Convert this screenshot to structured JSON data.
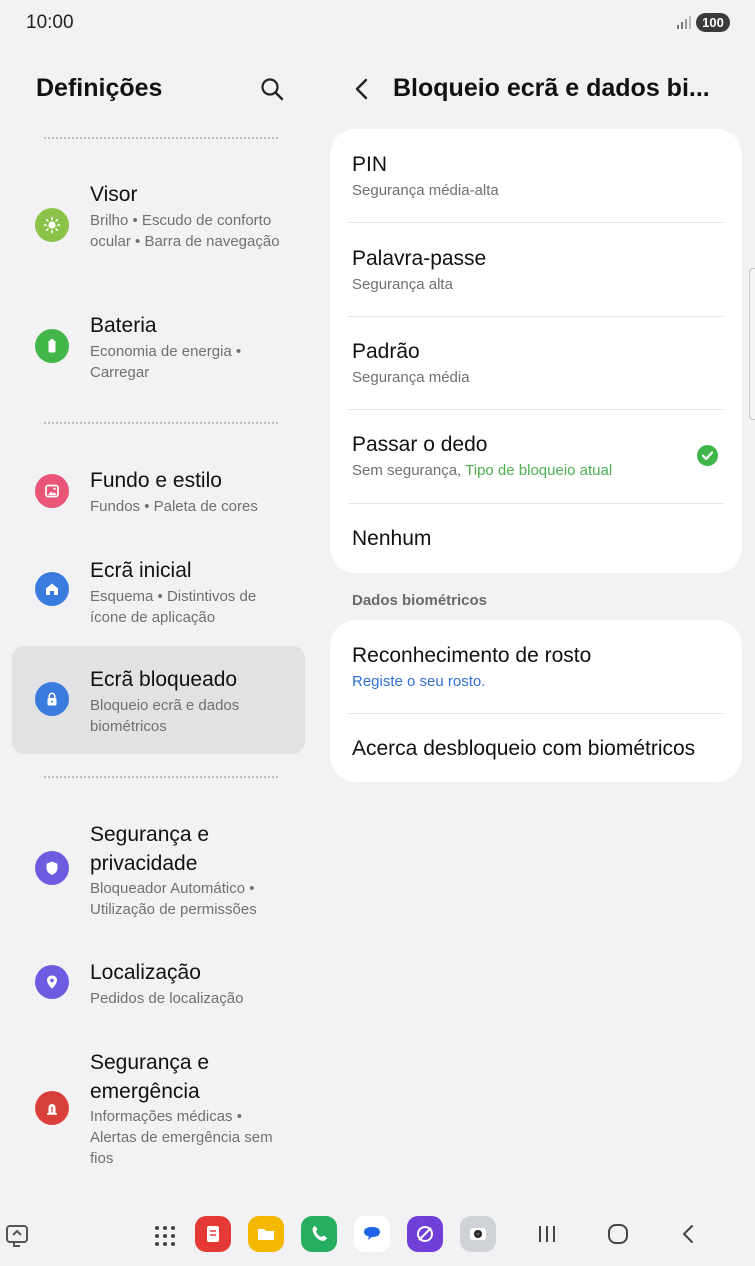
{
  "status_bar": {
    "time": "10:00",
    "battery": "100"
  },
  "settings_panel": {
    "title": "Definições",
    "items": [
      {
        "title": "Visor",
        "subtitle": "Brilho  •  Escudo de conforto ocular  •  Barra de navegação",
        "icon": "sun-icon",
        "color": "#8bc34a"
      },
      {
        "title": "Bateria",
        "subtitle": "Economia de energia  •  Carregar",
        "icon": "battery-icon",
        "color": "#43b649"
      },
      {
        "title": "Fundo e estilo",
        "subtitle": "Fundos  •  Paleta de cores",
        "icon": "image-icon",
        "color": "#e85577"
      },
      {
        "title": "Ecrã inicial",
        "subtitle": "Esquema  •  Distintivos de ícone de aplicação",
        "icon": "home-icon",
        "color": "#3a7be0"
      },
      {
        "title": "Ecrã bloqueado",
        "subtitle": "Bloqueio ecrã e dados biométricos",
        "icon": "lock-icon",
        "color": "#3a7be0"
      },
      {
        "title": "Segurança e privacidade",
        "subtitle": "Bloqueador Automático  •  Utilização de permissões",
        "icon": "shield-icon",
        "color": "#6d5be0"
      },
      {
        "title": "Localização",
        "subtitle": "Pedidos de localização",
        "icon": "location-pin-icon",
        "color": "#6d5be0"
      },
      {
        "title": "Segurança e emergência",
        "subtitle": "Informações médicas  •  Alertas de emergência sem fios",
        "icon": "emergency-icon",
        "color": "#d9403a"
      }
    ]
  },
  "detail_panel": {
    "title": "Bloqueio ecrã e dados bi...",
    "lock_types": [
      {
        "title": "PIN",
        "subtitle": "Segurança média-alta"
      },
      {
        "title": "Palavra-passe",
        "subtitle": "Segurança alta"
      },
      {
        "title": "Padrão",
        "subtitle": "Segurança média"
      },
      {
        "title": "Passar o dedo",
        "subtitle": "Sem segurança,",
        "subtitle_highlight": "Tipo de bloqueio atual",
        "selected": true
      },
      {
        "title": "Nenhum"
      }
    ],
    "biometrics_label": "Dados biométricos",
    "biometrics": [
      {
        "title": "Reconhecimento de rosto",
        "subtitle": "Registe o seu rosto."
      },
      {
        "title": "Acerca desbloqueio com biométricos"
      }
    ]
  },
  "navbar": {
    "apps": [
      "apps-grid-icon",
      "notes-app-icon",
      "files-app-icon",
      "phone-app-icon",
      "messages-app-icon",
      "internet-app-icon",
      "camera-app-icon"
    ],
    "buttons": [
      "recents-button",
      "home-button",
      "back-button"
    ]
  },
  "colors": {
    "accent_green": "#4caf50",
    "link_blue": "#2f6fd6"
  }
}
